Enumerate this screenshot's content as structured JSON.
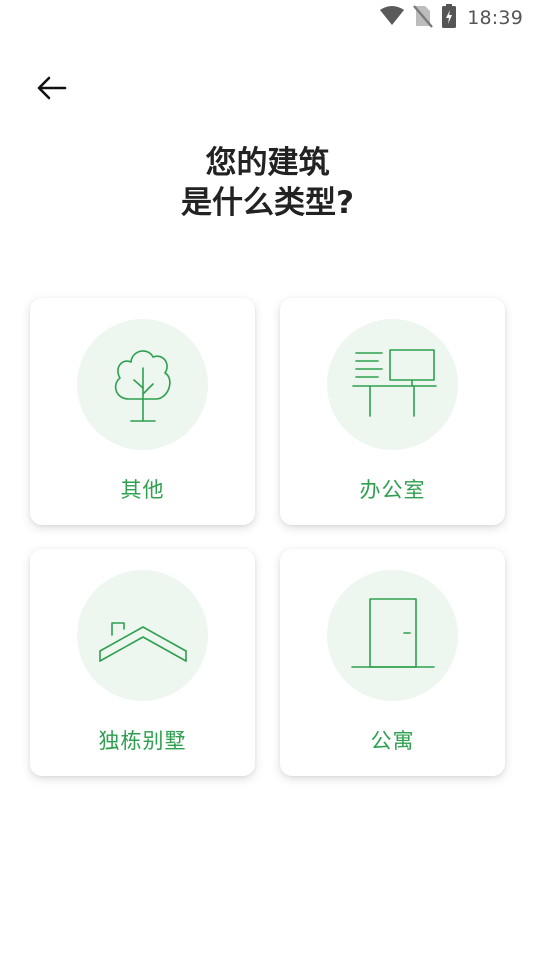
{
  "status_bar": {
    "time": "18:39",
    "icons": [
      "wifi-icon",
      "no-sim-icon",
      "battery-charging-icon"
    ]
  },
  "header": {
    "back_icon": "arrow-left-icon"
  },
  "title": {
    "line1": "您的建筑",
    "line2": "是什么类型?"
  },
  "options": [
    {
      "label": "其他",
      "icon": "tree-icon"
    },
    {
      "label": "办公室",
      "icon": "office-desk-icon"
    },
    {
      "label": "独栋别墅",
      "icon": "house-roof-icon"
    },
    {
      "label": "公寓",
      "icon": "door-icon"
    }
  ],
  "colors": {
    "accent": "#2fa04f",
    "icon_bg": "#edf6ef",
    "title": "#222222"
  }
}
